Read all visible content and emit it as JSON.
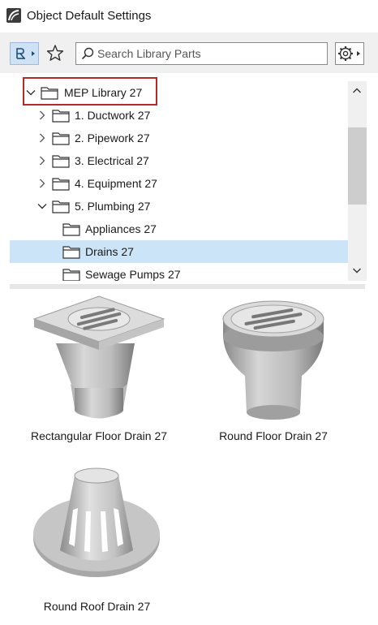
{
  "window": {
    "title": "Object Default Settings"
  },
  "toolbar": {
    "library_button_icon": "library-parts-icon",
    "favorites_icon": "star-icon",
    "search": {
      "placeholder": "Search Library Parts",
      "value": ""
    },
    "settings_icon": "gear-icon"
  },
  "tree": {
    "items": [
      {
        "label": "MEP Library 27",
        "level": 0,
        "expanded": true,
        "has_children": true,
        "selected": false,
        "highlighted": true
      },
      {
        "label": "1. Ductwork 27",
        "level": 1,
        "expanded": false,
        "has_children": true,
        "selected": false
      },
      {
        "label": "2. Pipework 27",
        "level": 1,
        "expanded": false,
        "has_children": true,
        "selected": false
      },
      {
        "label": "3. Electrical 27",
        "level": 1,
        "expanded": false,
        "has_children": true,
        "selected": false
      },
      {
        "label": "4. Equipment 27",
        "level": 1,
        "expanded": false,
        "has_children": true,
        "selected": false
      },
      {
        "label": "5. Plumbing 27",
        "level": 1,
        "expanded": true,
        "has_children": true,
        "selected": false
      },
      {
        "label": "Appliances 27",
        "level": 2,
        "expanded": false,
        "has_children": false,
        "selected": false
      },
      {
        "label": "Drains 27",
        "level": 2,
        "expanded": false,
        "has_children": false,
        "selected": true
      },
      {
        "label": "Sewage Pumps 27",
        "level": 2,
        "expanded": false,
        "has_children": false,
        "selected": false
      }
    ]
  },
  "parts": [
    {
      "label": "Rectangular Floor Drain 27",
      "icon": "rectangular-floor-drain"
    },
    {
      "label": "Round Floor Drain 27",
      "icon": "round-floor-drain"
    },
    {
      "label": "Round Roof Drain 27",
      "icon": "round-roof-drain"
    }
  ],
  "colors": {
    "selection": "#cce4f7",
    "highlight_border": "#b52a2a",
    "toolbar_bg": "#f0f0f0"
  }
}
